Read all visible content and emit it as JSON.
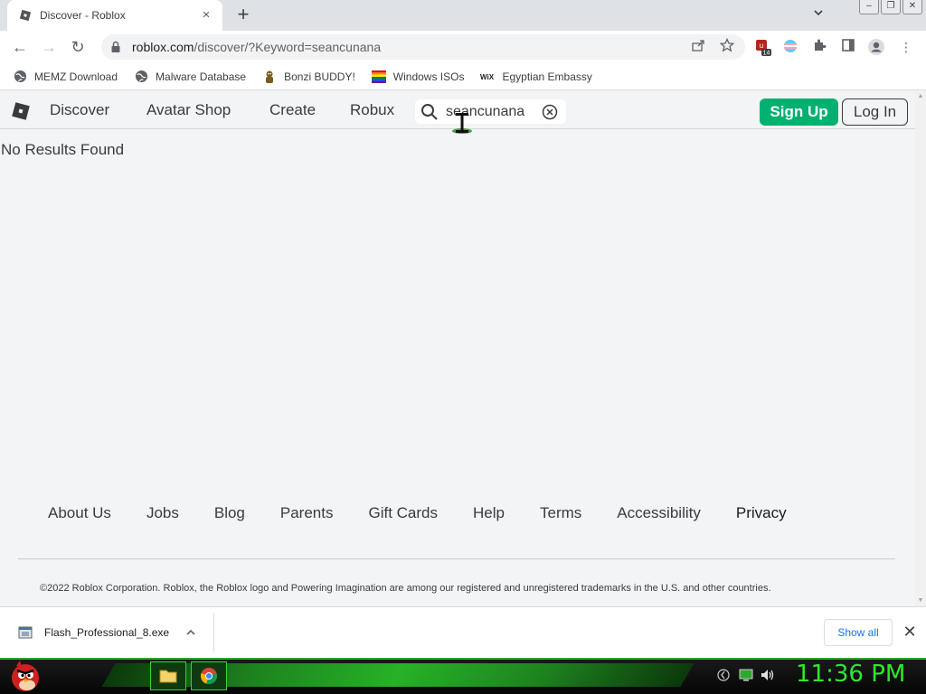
{
  "browser": {
    "tab": {
      "title": "Discover - Roblox",
      "close_glyph": "×",
      "favicon": "roblox-logo-icon"
    },
    "new_tab_glyph": "+",
    "tab_search_glyph": "⌄",
    "window_controls": {
      "minimize": "‒",
      "restore": "❐",
      "close": "✕"
    },
    "nav": {
      "back_glyph": "←",
      "forward_glyph": "→",
      "reload_glyph": "↻"
    },
    "url": {
      "host": "roblox.com",
      "path": "/discover/?Keyword=seancunana"
    },
    "omnibox_icons": [
      "share-icon",
      "star-icon"
    ],
    "extensions": {
      "badge_count": "14"
    },
    "menu_glyph": "⋮"
  },
  "bookmarks": [
    {
      "label": "MEMZ Download",
      "icon": "globe-icon"
    },
    {
      "label": "Malware Database",
      "icon": "globe-icon"
    },
    {
      "label": "Bonzi BUDDY!",
      "icon": "bonzi-icon"
    },
    {
      "label": "Windows ISOs",
      "icon": "rainbow-flag-icon"
    },
    {
      "label": "Egyptian Embassy",
      "icon": "wix-icon"
    }
  ],
  "roblox": {
    "nav": [
      "Discover",
      "Avatar Shop",
      "Create",
      "Robux"
    ],
    "search": {
      "value": "seancunana"
    },
    "signup_label": "Sign Up",
    "login_label": "Log In",
    "no_results": "No Results Found",
    "footer_links": [
      "About Us",
      "Jobs",
      "Blog",
      "Parents",
      "Gift Cards",
      "Help",
      "Terms",
      "Accessibility",
      "Privacy"
    ],
    "copyright": "©2022 Roblox Corporation. Roblox, the Roblox logo and Powering Imagination are among our registered and unregistered trademarks in the U.S. and other countries."
  },
  "downloads": {
    "file_name": "Flash_Professional_8.exe",
    "chevron_glyph": "⌃",
    "show_all_label": "Show all",
    "close_glyph": "✕"
  },
  "taskbar": {
    "clock": "11:36 PM",
    "accent_color": "#2ee82e"
  },
  "colors": {
    "roblox_green": "#00b06f",
    "page_bg": "#f2f4f5",
    "link_blue": "#1a73e8"
  }
}
